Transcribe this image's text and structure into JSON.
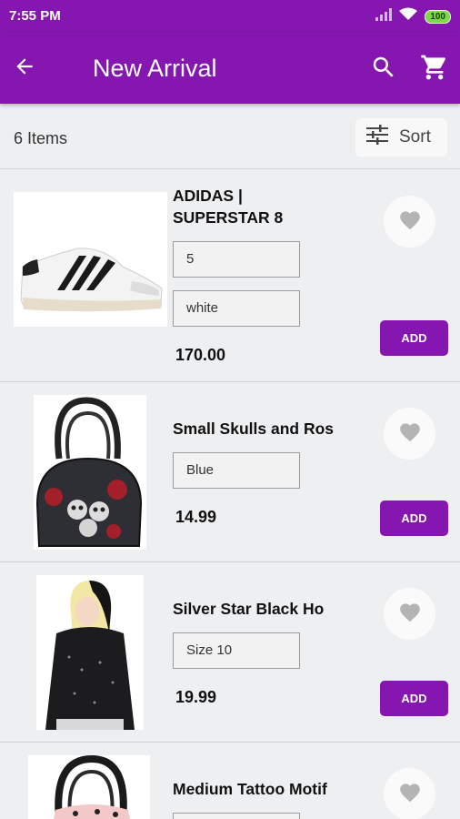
{
  "status_bar": {
    "time": "7:55 PM",
    "battery": "100"
  },
  "app_bar": {
    "title": "New Arrival"
  },
  "toolbar": {
    "item_count": "6 Items",
    "sort_label": "Sort"
  },
  "products": [
    {
      "name_line1": "ADIDAS |",
      "name_line2": "SUPERSTAR 8",
      "options": [
        "5",
        "white"
      ],
      "price": "170.00",
      "add_label": "ADD"
    },
    {
      "name_line1": "Small Skulls and Ros",
      "options": [
        "Blue"
      ],
      "price": "14.99",
      "add_label": "ADD"
    },
    {
      "name_line1": "Silver Star Black Ho",
      "options": [
        "Size 10"
      ],
      "price": "19.99",
      "add_label": "ADD"
    },
    {
      "name_line1": "Medium Tattoo Motif",
      "options": [],
      "price": "",
      "add_label": ""
    }
  ],
  "colors": {
    "brand": "#8516b0",
    "background": "#eeeff1"
  },
  "icons": [
    "signal-icon",
    "wifi-icon",
    "battery-icon",
    "back-arrow-icon",
    "search-icon",
    "cart-icon",
    "filter-sliders-icon",
    "heart-icon"
  ]
}
